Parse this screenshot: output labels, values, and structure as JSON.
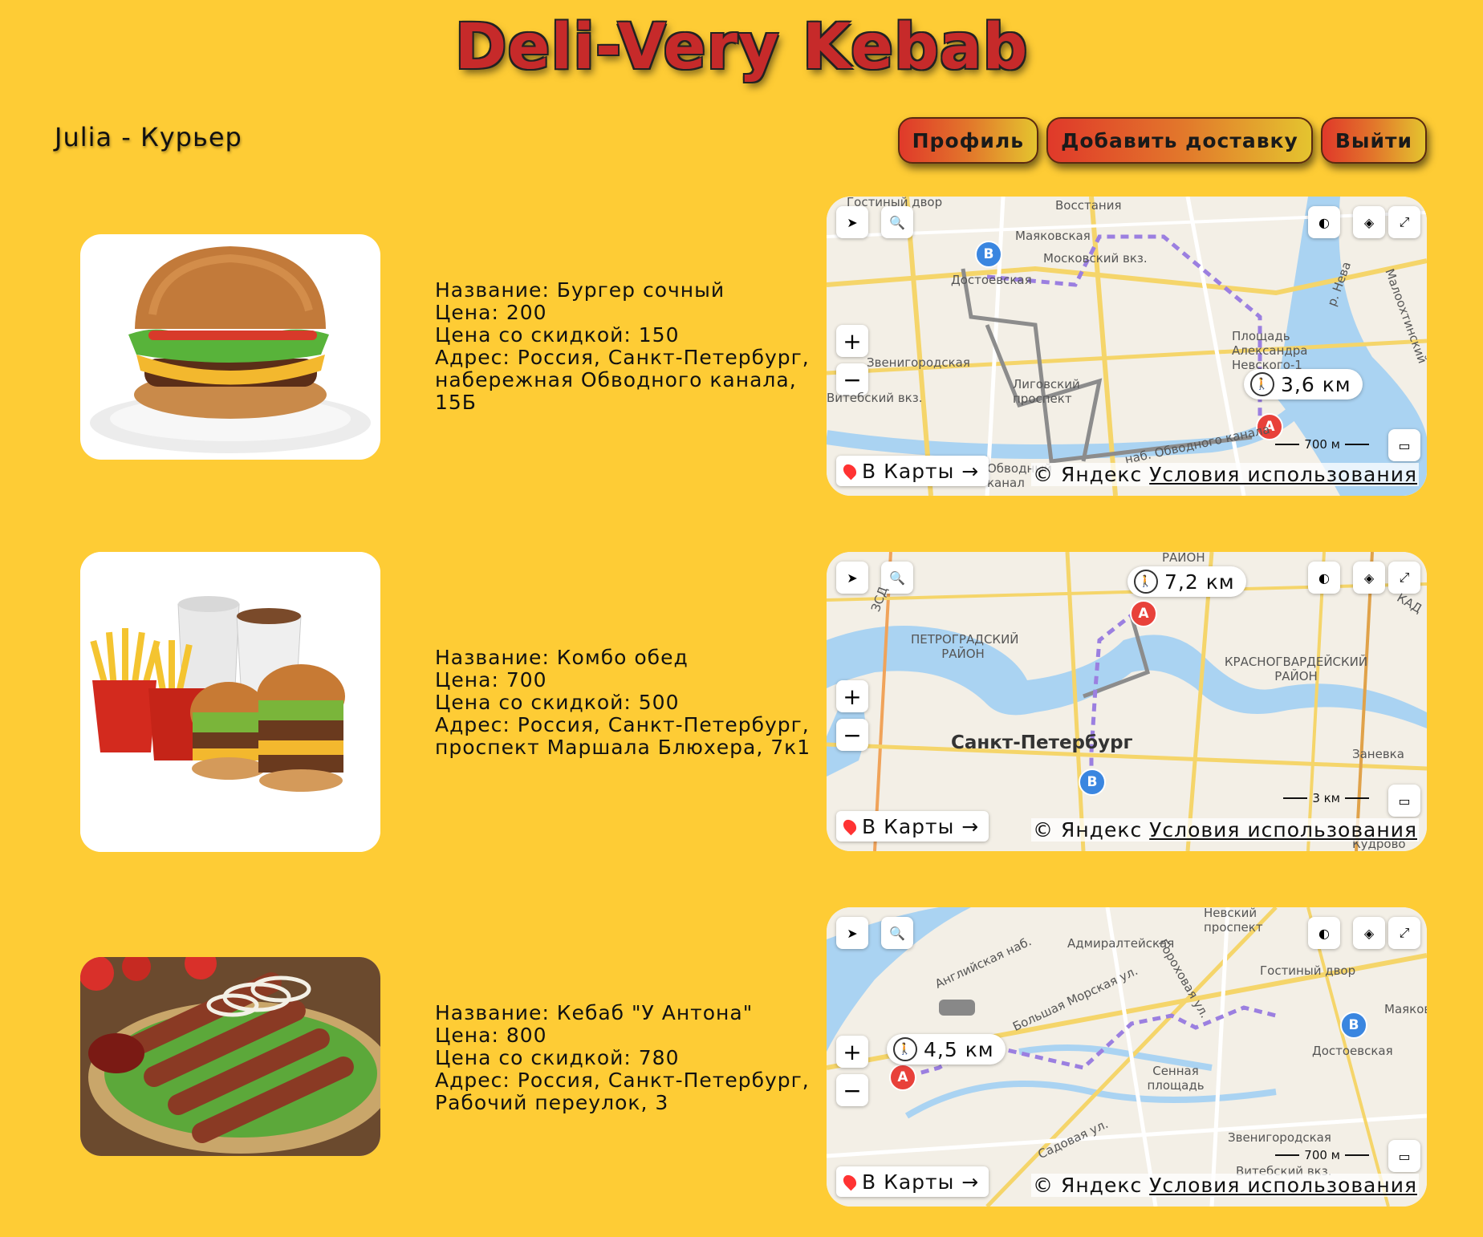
{
  "header": {
    "title": "Deli-Very Kebab",
    "user": "Julia - Курьер",
    "buttons": {
      "profile": "Профиль",
      "add_delivery": "Добавить доставку",
      "logout": "Выйти"
    }
  },
  "deliveries": [
    {
      "name": "Название: Бургер сочный",
      "price": "Цена: 200",
      "discount": "Цена со скидкой: 150",
      "address": "Адрес: Россия, Санкт-Петербург, набережная Обводного канала, 15Б",
      "map": {
        "distance": "3,6 км",
        "scale": "700 м",
        "to_maps": "В Карты →",
        "copyright": "© Яндекс",
        "terms": "Условия использования",
        "labels": [
          "Гостиный двор",
          "Восстания",
          "Маяковская",
          "Московский вкз.",
          "Достоевская",
          "Площадь Александра Невского-1",
          "Лиговский проспект",
          "Звенигородская",
          "Витебский вкз.",
          "наб. Обводного канала",
          "Обводный канал",
          "р. Нева",
          "Малоохтинский"
        ]
      }
    },
    {
      "name": "Название: Комбо обед",
      "price": "Цена: 700",
      "discount": "Цена со скидкой: 500",
      "address": "Адрес: Россия, Санкт-Петербург, проспект Маршала Блюхера, 7к1",
      "map": {
        "distance": "7,2 км",
        "scale": "3 км",
        "to_maps": "В Карты →",
        "copyright": "© Яндекс",
        "terms": "Условия использования",
        "labels": [
          "Санкт-Петербург",
          "ПЕТРОГРАДСКИЙ РАЙОН",
          "КРАСНОГВАРДЕЙСКИЙ РАЙОН",
          "Заневка",
          "Кудрово",
          "РАЙОН",
          "КАД",
          "ЗСД"
        ]
      }
    },
    {
      "name": "Название: Кебаб \"У Антона\"",
      "price": "Цена: 800",
      "discount": "Цена со скидкой: 780",
      "address": "Адрес: Россия, Санкт-Петербург, Рабочий переулок, 3",
      "map": {
        "distance": "4,5 км",
        "scale": "700 м",
        "to_maps": "В Карты →",
        "copyright": "© Яндекс",
        "terms": "Условия использования",
        "labels": [
          "Невский проспект",
          "Адмиралтейская",
          "Гостиный двор",
          "Маяковская",
          "Достоевская",
          "Сенная площадь",
          "Звенигородская",
          "Витебский вкз.",
          "Садовая ул.",
          "Большая Морская ул.",
          "Гороховая ул.",
          "Английская наб."
        ]
      }
    }
  ],
  "colors": {
    "background": "#fecc35",
    "title": "#c62a2a",
    "route": "#9b7fe0",
    "marker_a": "#e8413a",
    "marker_b": "#3a86e0"
  }
}
